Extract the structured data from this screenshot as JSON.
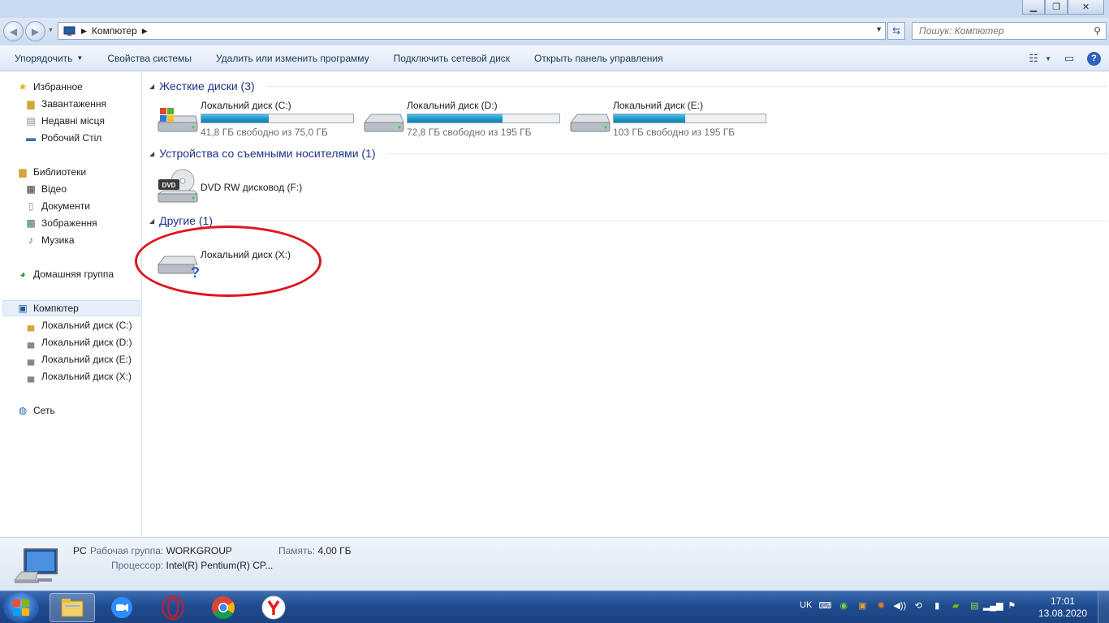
{
  "window": {
    "minimize_icon": "minimize-icon",
    "maximize_icon": "restore-icon",
    "close_icon": "close-icon"
  },
  "address": {
    "location": "Компютер",
    "search_placeholder": "Пошук: Компютер"
  },
  "toolbar": {
    "organize": "Упорядочить",
    "system_properties": "Свойства системы",
    "uninstall": "Удалить или изменить программу",
    "map_drive": "Подключить сетевой диск",
    "control_panel": "Открыть панель управления"
  },
  "sidebar": {
    "favorites": "Избранное",
    "downloads": "Завантаження",
    "recent": "Недавні місця",
    "desktop": "Робочий Стіл",
    "libraries": "Библиотеки",
    "video": "Відео",
    "documents": "Документи",
    "pictures": "Зображення",
    "music": "Музика",
    "homegroup": "Домашняя группа",
    "computer": "Компютер",
    "drive_c": "Локальний диск (C:)",
    "drive_d": "Локальний диск (D:)",
    "drive_e": "Локальний диск (E:)",
    "drive_x": "Локальний диск (X:)",
    "network": "Сеть"
  },
  "groups": {
    "hard_disks": "Жесткие диски (3)",
    "removable": "Устройства со съемными носителями (1)",
    "other": "Другие (1)"
  },
  "drives": {
    "c": {
      "name": "Локальний диск (C:)",
      "free": "41,8 ГБ свободно из 75,0 ГБ",
      "used_fraction": 0.443
    },
    "d": {
      "name": "Локальний диск (D:)",
      "free": "72,8 ГБ свободно из 195 ГБ",
      "used_fraction": 0.627
    },
    "e": {
      "name": "Локальний диск (E:)",
      "free": "103 ГБ свободно из 195 ГБ",
      "used_fraction": 0.472
    },
    "dvd": {
      "name": "DVD RW дисковод (F:)",
      "label": "DVD"
    },
    "x": {
      "name": "Локальний диск (X:)"
    }
  },
  "details": {
    "pc_name": "PC",
    "workgroup_label": "Рабочая группа:",
    "workgroup_value": "WORKGROUP",
    "memory_label": "Память:",
    "memory_value": "4,00 ГБ",
    "cpu_label": "Процессор:",
    "cpu_value": "Intel(R) Pentium(R) CP..."
  },
  "taskbar": {
    "lang": "UK",
    "time": "17:01",
    "date": "13.08.2020"
  },
  "colors": {
    "accent": "#1e3287",
    "bar_fill": "#1e95c9",
    "highlight_circle": "#e0141e"
  }
}
